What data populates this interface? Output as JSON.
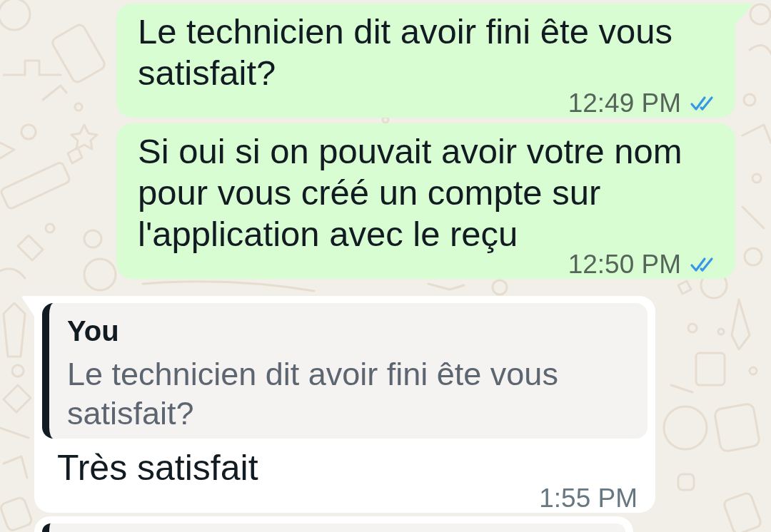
{
  "messages": [
    {
      "kind": "outgoing",
      "tail": true,
      "text": "Le technicien dit avoir fini ête vous satisfait?",
      "time": "12:49 PM",
      "read": true
    },
    {
      "kind": "outgoing",
      "tail": false,
      "text": "Si oui si on pouvait avoir votre nom pour vous créé un compte sur l'application avec le reçu",
      "time": "12:50 PM",
      "read": true
    },
    {
      "kind": "incoming",
      "tail": true,
      "quote": {
        "author": "You",
        "text": "Le technicien dit avoir fini ête vous satisfait?"
      },
      "text": "Très satisfait",
      "time": "1:55 PM"
    },
    {
      "kind": "incoming",
      "tail": false,
      "quoted": true
    }
  ]
}
